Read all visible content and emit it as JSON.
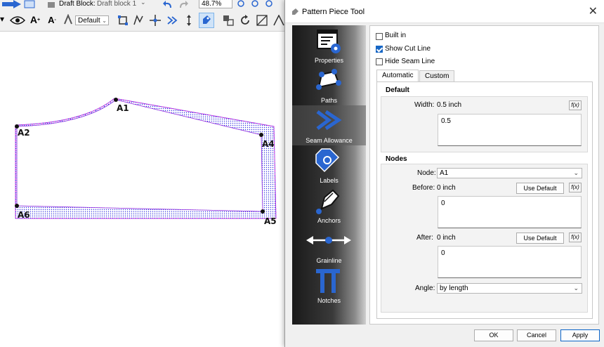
{
  "toolbar": {
    "draft_block_label": "Draft Block:",
    "draft_block_value": "Draft block 1",
    "zoom_value": "48.7%",
    "label_style_value": "Default"
  },
  "canvas": {
    "points": [
      "A1",
      "A2",
      "A4",
      "A5",
      "A6"
    ]
  },
  "dialog": {
    "title": "Pattern Piece Tool",
    "sidebar": [
      {
        "label": "Properties",
        "icon": "properties-icon"
      },
      {
        "label": "Paths",
        "icon": "paths-icon"
      },
      {
        "label": "Seam Allowance",
        "icon": "seam-allowance-icon"
      },
      {
        "label": "Labels",
        "icon": "labels-icon"
      },
      {
        "label": "Anchors",
        "icon": "anchors-icon"
      },
      {
        "label": "Grainline",
        "icon": "grainline-icon"
      },
      {
        "label": "Notches",
        "icon": "notches-icon"
      }
    ],
    "active_sidebar": "Seam Allowance",
    "checkboxes": [
      {
        "label": "Built in",
        "checked": false
      },
      {
        "label": "Show Cut Line",
        "checked": true
      },
      {
        "label": "Hide Seam Line",
        "checked": false
      }
    ],
    "tabs": [
      {
        "label": "Automatic",
        "selected": true
      },
      {
        "label": "Custom",
        "selected": false
      }
    ],
    "default_group": {
      "title": "Default",
      "width_label": "Width:",
      "width_value": "0.5 inch",
      "width_formula": "0.5"
    },
    "nodes_group": {
      "title": "Nodes",
      "node_label": "Node:",
      "node_value": "A1",
      "before_label": "Before:",
      "before_value": "0 inch",
      "before_formula": "0",
      "after_label": "After:",
      "after_value": "0 inch",
      "after_formula": "0",
      "angle_label": "Angle:",
      "angle_value": "by length",
      "use_default_label": "Use Default"
    },
    "fx_label": "f(x)",
    "buttons": {
      "ok": "OK",
      "cancel": "Cancel",
      "apply": "Apply"
    }
  },
  "colors": {
    "accent": "#1666c5",
    "seam_allowance": "#3a3ae0",
    "cut_line": "#e030e0",
    "sidebar_icon": "#2a66d0"
  }
}
